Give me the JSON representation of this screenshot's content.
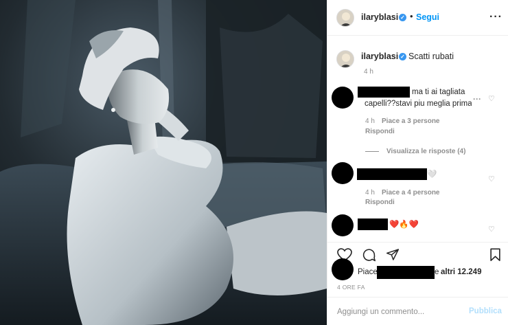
{
  "header": {
    "username": "ilaryblasi",
    "verified_icon": "verified-badge-icon",
    "separator": "•",
    "follow_label": "Segui",
    "more_icon": "more-options-icon"
  },
  "caption": {
    "username": "ilaryblasi",
    "text": "Scatti rubati",
    "time": "4 h"
  },
  "comments": [
    {
      "text_line1": "ma ti ai tagliata",
      "text_line2": "capelli??stavi piu meglia prima",
      "time": "4 h",
      "likes": "Piace a 3 persone",
      "reply_label": "Rispondi",
      "view_replies": "Visualizza le risposte (4)"
    },
    {
      "emoji": "🤍",
      "time": "4 h",
      "likes": "Piace a 4 persone",
      "reply_label": "Rispondi"
    },
    {
      "emoji": "❤️🔥❤️"
    }
  ],
  "actions": {
    "like_icon": "heart-icon",
    "comment_icon": "comment-icon",
    "share_icon": "share-icon",
    "save_icon": "bookmark-icon"
  },
  "likes": {
    "prefix": "Piace a",
    "suffix": "e",
    "others": "altri 12.249"
  },
  "post_time": "4 ORE FA",
  "comment_box": {
    "placeholder": "Aggiungi un commento...",
    "publish_label": "Pubblica"
  },
  "colors": {
    "link_blue": "#0095f6",
    "publish_disabled": "#b2dffc",
    "muted": "#8e8e8e",
    "verified": "#3897f0"
  }
}
